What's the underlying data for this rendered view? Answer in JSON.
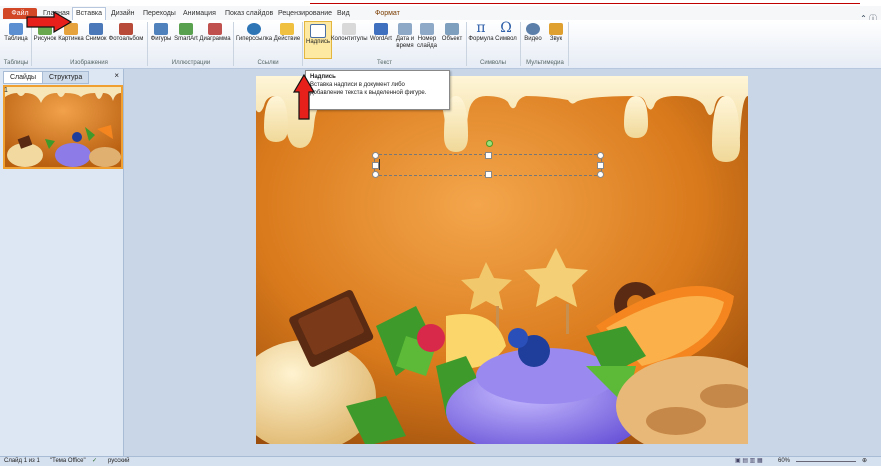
{
  "tabs": {
    "file": "Файл",
    "home": "Главная",
    "insert": "Вставка",
    "design": "Дизайн",
    "transitions": "Переходы",
    "animations": "Анимация",
    "slideshow": "Показ слайдов",
    "review": "Рецензирование",
    "view": "Вид",
    "format": "Формат"
  },
  "ribbon": {
    "table": "Таблица",
    "picture": "Рисунок",
    "clipart": "Картинка",
    "screenshot": "Снимок",
    "album": "Фотоальбом",
    "shapes": "Фигуры",
    "smartart": "SmartArt",
    "chart": "Диаграмма",
    "hyperlink": "Гиперссылка",
    "action": "Действие",
    "textbox": "Надпись",
    "headerfooter": "Колонтитулы",
    "wordart": "WordArt",
    "datetime": "Дата и время",
    "slidenumber": "Номер слайда",
    "object": "Объект",
    "equation": "Формула",
    "symbol": "Символ",
    "video": "Видео",
    "audio": "Звук"
  },
  "groups": {
    "tables": "Таблицы",
    "images": "Изображения",
    "illustrations": "Иллюстрации",
    "links": "Ссылки",
    "text": "Текст",
    "symbols": "Символы",
    "media": "Мультимедиа"
  },
  "tooltip": {
    "title": "Надпись",
    "line1": "Вставка надписи в документ либо",
    "line2": "добавление текста к выделенной фигуре."
  },
  "panel": {
    "slides_tab": "Слайды",
    "outline_tab": "Структура",
    "close": "×",
    "thumb_number": "1"
  },
  "status": {
    "slide": "Слайд 1 из 1",
    "theme": "\"Тема Office\"",
    "language": "русский",
    "zoom": "60%"
  },
  "colors": {
    "accent": "#d24726",
    "arrow": "#e8201c"
  }
}
